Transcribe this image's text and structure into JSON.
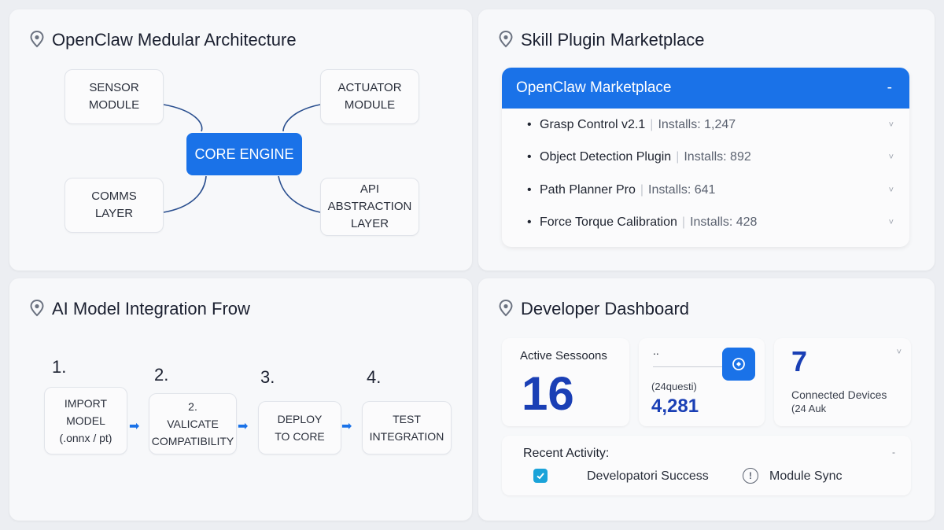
{
  "arch": {
    "title": "OpenClaw Medular Architecture",
    "sensor": "SENSOR\nMODULE",
    "actuator": "ACTUATOR\nMODULE",
    "core": "CORE ENGINE",
    "comms": "COMMS\nLAYER",
    "api": "API\nABSTRACTION\nLAYER"
  },
  "market": {
    "title": "Skill Plugin Marketplace",
    "header": "OpenClaw Marketplace",
    "header_chevron": "-",
    "items": [
      {
        "bullet": "•",
        "name": "Grasp Control v2.1",
        "installs": "Installs: 1,247",
        "chevron": "˅"
      },
      {
        "bullet": "•",
        "name": "Object Detection Plugin",
        "installs": "Installs: 892",
        "chevron": "˅"
      },
      {
        "bullet": "•",
        "name": "Path Planner Pro",
        "installs": "Installs: 641",
        "chevron": "˅"
      },
      {
        "bullet": "•",
        "name": "Force Torque Calibration",
        "installs": "Installs: 428",
        "chevron": "˅"
      }
    ]
  },
  "flow": {
    "title": "AI Model Integration Frow",
    "steps": [
      {
        "num": "1.",
        "label": "IMPORT\nMODEL\n(.onnx / pt)"
      },
      {
        "num": "2.",
        "label": "2.\nVALICATE\nCOMPATIBILITY"
      },
      {
        "num": "3.",
        "label": "DEPLOY\nTO CORE"
      },
      {
        "num": "4.",
        "label": "TEST\nINTEGRATION"
      }
    ],
    "arrow": "➡"
  },
  "dash": {
    "title": "Developer Dashboard",
    "sessions_label": "Active Sessoons",
    "sessions_value": "16",
    "api_dots": "..",
    "api_label": "(24questi)",
    "api_value": "4,281",
    "devices_value": "7",
    "devices_label": "Connected Devices",
    "devices_sub": "(24 Auk",
    "devices_chevron": "˅",
    "recent_label": "Recent Activity:",
    "recent_chevron": "-",
    "activity_1": "Developatori Success",
    "activity_2": "Module Sync",
    "accent": "#1a72e8"
  }
}
